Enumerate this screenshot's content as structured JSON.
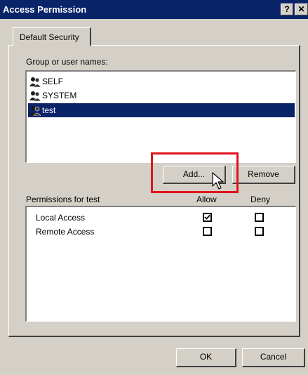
{
  "window": {
    "title": "Access Permission",
    "help_glyph": "?",
    "close_glyph": "✕"
  },
  "tab": {
    "label": "Default Security"
  },
  "group": {
    "label": "Group or user names:",
    "users": [
      {
        "name": "SELF",
        "icon": "user-group-icon",
        "selected": false
      },
      {
        "name": "SYSTEM",
        "icon": "user-group-icon",
        "selected": false
      },
      {
        "name": "test",
        "icon": "user-group-icon",
        "selected": true
      }
    ],
    "add_label": "Add...",
    "remove_label": "Remove"
  },
  "permissions": {
    "header": "Permissions for test",
    "allow_header": "Allow",
    "deny_header": "Deny",
    "rows": [
      {
        "name": "Local Access",
        "allow": true,
        "deny": false
      },
      {
        "name": "Remote Access",
        "allow": false,
        "deny": false
      }
    ]
  },
  "footer": {
    "ok_label": "OK",
    "cancel_label": "Cancel"
  },
  "colors": {
    "title_bar": "#0a246a",
    "selection": "#0a246a",
    "highlight_box": "#e0141e",
    "face": "#d4d0c8"
  }
}
